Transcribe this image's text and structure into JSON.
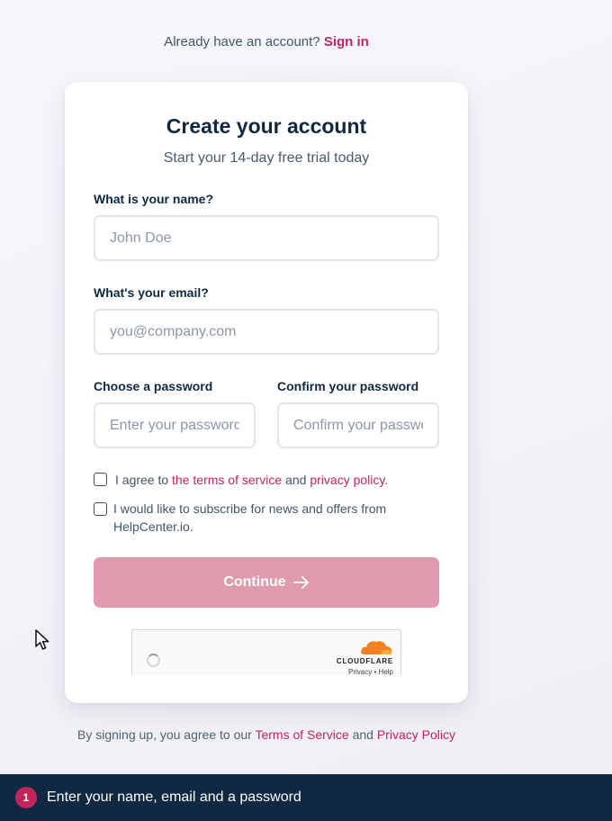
{
  "header": {
    "prompt": "Already have an account?",
    "sign_in_label": "Sign in"
  },
  "card": {
    "title": "Create your account",
    "subtitle": "Start your 14-day free trial today"
  },
  "form": {
    "name": {
      "label": "What is your name?",
      "placeholder": "John Doe",
      "value": ""
    },
    "email": {
      "label": "What's your email?",
      "placeholder": "you@company.com",
      "value": ""
    },
    "password": {
      "label": "Choose a password",
      "placeholder": "Enter your password",
      "value": ""
    },
    "confirm": {
      "label": "Confirm your password",
      "placeholder": "Confirm your password",
      "value": ""
    },
    "terms": {
      "checked": false,
      "prefix": "I agree to",
      "tos_link": "the terms of service",
      "and": "and",
      "privacy_link": "privacy policy",
      "suffix": "."
    },
    "newsletter": {
      "checked": false,
      "line1": "I would like to subscribe for news and offers from",
      "line2": "HelpCenter.io."
    },
    "continue_label": "Continue",
    "continue_disabled": true
  },
  "captcha": {
    "brand": "CLOUDFLARE",
    "privacy": "Privacy",
    "separator": "•",
    "help": "Help",
    "brand_color": "#f48120"
  },
  "footer": {
    "prefix": "By signing up, you agree to our",
    "tos_link": "Terms of Service",
    "and": "and",
    "privacy_link": "Privacy Policy"
  },
  "bottom_bar": {
    "step_number": "1",
    "instruction": "Enter your name, email and a password"
  },
  "colors": {
    "accent": "#c2255c",
    "button_disabled": "#e09aae",
    "navy": "#0f2942"
  }
}
